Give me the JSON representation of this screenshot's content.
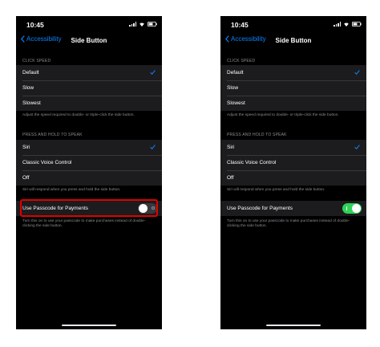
{
  "colors": {
    "accent": "#0a84ff",
    "highlight": "#e00000",
    "toggle_on": "#30d158",
    "toggle_off": "#39393d"
  },
  "screens": [
    {
      "time": "10:45",
      "back_label": "Accessibility",
      "title": "Side Button",
      "click_speed_header": "CLICK SPEED",
      "click_speed_options": [
        "Default",
        "Slow",
        "Slowest"
      ],
      "click_speed_selected": "Default",
      "click_speed_note": "Adjust the speed required to double- or triple-click the side button.",
      "press_hold_header": "PRESS AND HOLD TO SPEAK",
      "press_hold_options": [
        "Siri",
        "Classic Voice Control",
        "Off"
      ],
      "press_hold_selected": "Siri",
      "press_hold_note": "Siri will respond when you press and hold the side button.",
      "passcode_label": "Use Passcode for Payments",
      "passcode_enabled": false,
      "passcode_note": "Turn this on to use your passcode to make purchases instead of double-clicking the side button.",
      "highlighted": true
    },
    {
      "time": "10:45",
      "back_label": "Accessibility",
      "title": "Side Button",
      "click_speed_header": "CLICK SPEED",
      "click_speed_options": [
        "Default",
        "Slow",
        "Slowest"
      ],
      "click_speed_selected": "Default",
      "click_speed_note": "Adjust the speed required to double- or triple-click the side button.",
      "press_hold_header": "PRESS AND HOLD TO SPEAK",
      "press_hold_options": [
        "Siri",
        "Classic Voice Control",
        "Off"
      ],
      "press_hold_selected": "Siri",
      "press_hold_note": "Siri will respond when you press and hold the side button.",
      "passcode_label": "Use Passcode for Payments",
      "passcode_enabled": true,
      "passcode_note": "Turn this on to use your passcode to make purchases instead of double-clicking the side button.",
      "highlighted": false
    }
  ]
}
